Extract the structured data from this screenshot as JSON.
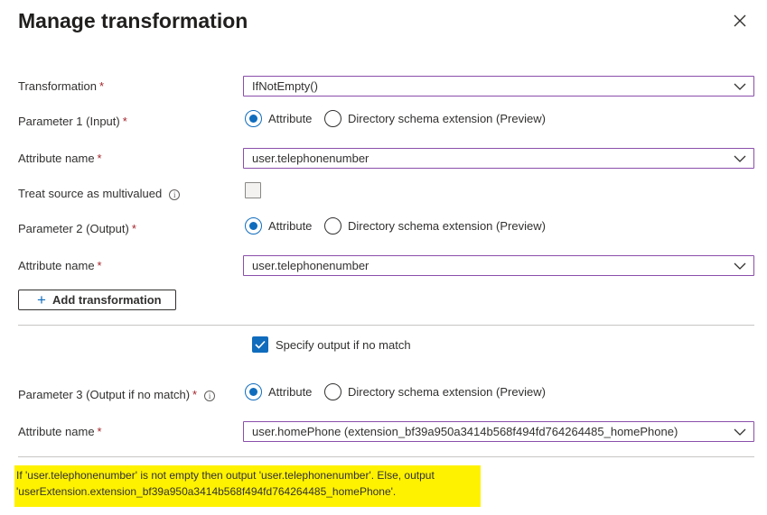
{
  "dialog": {
    "title": "Manage transformation"
  },
  "required_mark": "*",
  "info_glyph": "i",
  "fields": {
    "transformation": {
      "label": "Transformation",
      "value": "IfNotEmpty()"
    },
    "param1": {
      "label": "Parameter 1 (Input)",
      "options": [
        "Attribute",
        "Directory schema extension (Preview)"
      ],
      "selected": "Attribute"
    },
    "attr_name_1": {
      "label": "Attribute name",
      "value": "user.telephonenumber"
    },
    "treat_multivalued": {
      "label": "Treat source as multivalued",
      "checked": false
    },
    "param2": {
      "label": "Parameter 2 (Output)",
      "options": [
        "Attribute",
        "Directory schema extension (Preview)"
      ],
      "selected": "Attribute"
    },
    "attr_name_2": {
      "label": "Attribute name",
      "value": "user.telephonenumber"
    },
    "add_transformation": {
      "label": "Add transformation"
    },
    "specify_output": {
      "label": "Specify output if no match",
      "checked": true
    },
    "param3": {
      "label": "Parameter 3 (Output if no match)",
      "options": [
        "Attribute",
        "Directory schema extension (Preview)"
      ],
      "selected": "Attribute"
    },
    "attr_name_3": {
      "label": "Attribute name",
      "value": "user.homePhone (extension_bf39a950a3414b568f494fd764264485_homePhone)"
    }
  },
  "summary": {
    "line1": "If 'user.telephonenumber' is not empty then output 'user.telephonenumber'. Else, output",
    "line2": "'userExtension.extension_bf39a950a3414b568f494fd764264485_homePhone'."
  },
  "icons": {
    "close": "close-icon",
    "chevron": "chevron-down-icon",
    "plus": "plus-icon",
    "info": "info-icon",
    "check": "checkmark-icon"
  },
  "colors": {
    "accent": "#0f6cbd",
    "required": "#a4262c",
    "dropdown_border": "#8a4eab",
    "highlight": "#fff200"
  }
}
